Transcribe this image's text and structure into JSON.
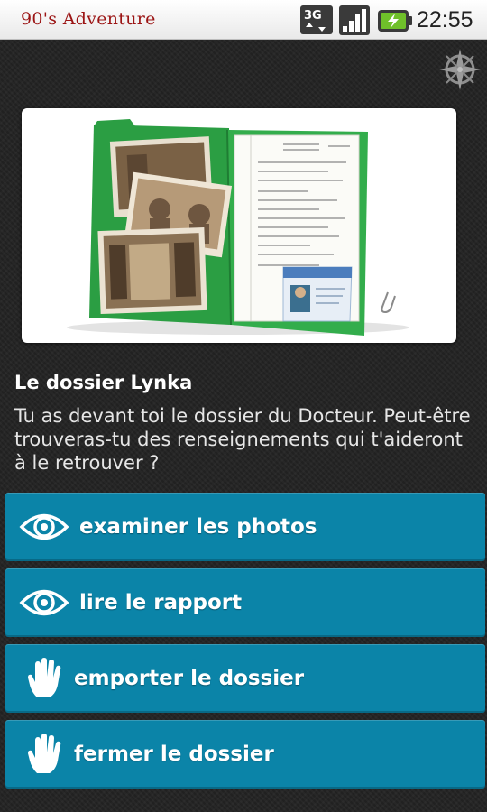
{
  "status_bar": {
    "app_title": "90's Adventure",
    "network_label": "3G",
    "time": "22:55"
  },
  "compass": {
    "icon": "compass-icon"
  },
  "scene": {
    "image": "dossier-folder-illustration",
    "title": "Le dossier Lynka",
    "text": "Tu as devant toi le dossier du Docteur. Peut-être trouveras-tu des renseignements qui t'aideront à le retrouver ?"
  },
  "actions": [
    {
      "label": "examiner les photos",
      "icon": "eye-icon"
    },
    {
      "label": "lire le rapport",
      "icon": "eye-icon"
    },
    {
      "label": "emporter le dossier",
      "icon": "hand-icon"
    },
    {
      "label": "fermer le dossier",
      "icon": "hand-icon"
    }
  ],
  "colors": {
    "button_bg": "#0b84a8",
    "app_title": "#9b1414",
    "folder_green": "#2fa84a"
  }
}
